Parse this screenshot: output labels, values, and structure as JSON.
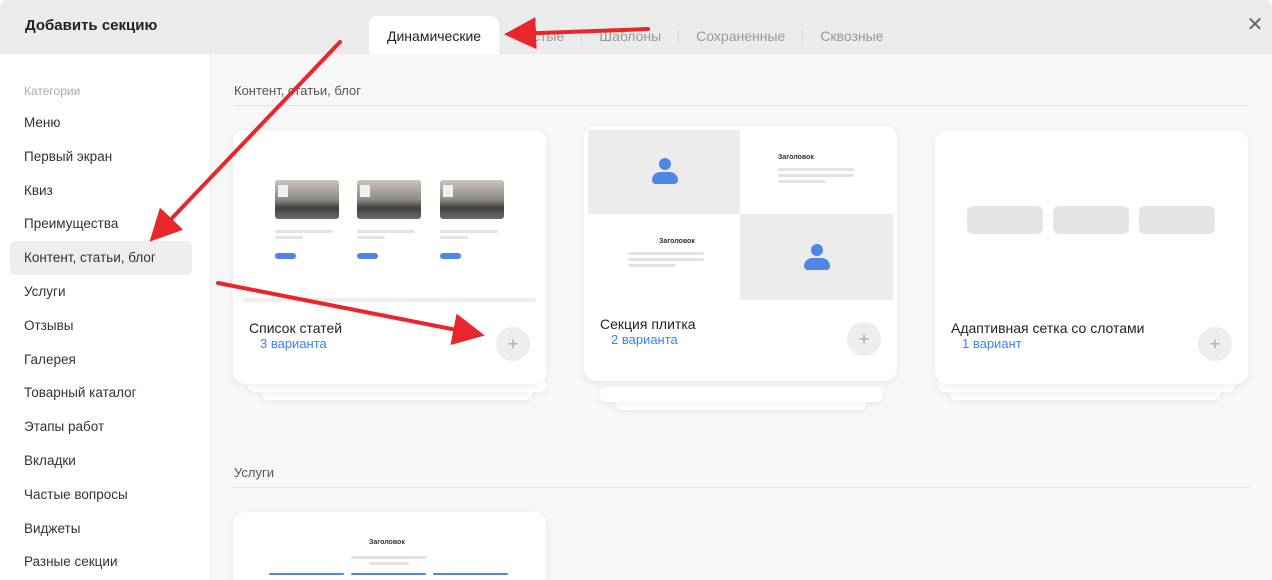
{
  "header": {
    "title": "Добавить секцию",
    "tabs": [
      {
        "label": "Динамические",
        "active": true
      },
      {
        "label": "Пустые",
        "active": false
      },
      {
        "label": "Шаблоны",
        "active": false
      },
      {
        "label": "Сохраненные",
        "active": false
      },
      {
        "label": "Сквозные",
        "active": false
      }
    ],
    "close_icon": "close-icon"
  },
  "sidebar": {
    "heading": "Категории",
    "items": [
      {
        "label": "Меню",
        "active": false
      },
      {
        "label": "Первый экран",
        "active": false
      },
      {
        "label": "Квиз",
        "active": false
      },
      {
        "label": "Преимущества",
        "active": false
      },
      {
        "label": "Контент, статьи, блог",
        "active": true
      },
      {
        "label": "Услуги",
        "active": false
      },
      {
        "label": "Отзывы",
        "active": false
      },
      {
        "label": "Галерея",
        "active": false
      },
      {
        "label": "Товарный каталог",
        "active": false
      },
      {
        "label": "Этапы работ",
        "active": false
      },
      {
        "label": "Вкладки",
        "active": false
      },
      {
        "label": "Частые вопросы",
        "active": false
      },
      {
        "label": "Виджеты",
        "active": false
      },
      {
        "label": "Разные секции",
        "active": false
      }
    ]
  },
  "main": {
    "sections": [
      {
        "title": "Контент, статьи, блог",
        "cards": [
          {
            "name": "Список статей",
            "variants": "3 варианта",
            "add": "+"
          },
          {
            "name": "Секция плитка",
            "variants": "2 варианта",
            "add": "+",
            "preview_heading_1": "Заголовок",
            "preview_heading_2": "Заголовок"
          },
          {
            "name": "Адаптивная сетка со слотами",
            "variants": "1 вариант",
            "add": "+"
          }
        ]
      },
      {
        "title": "Услуги",
        "cards": [
          {
            "preview_heading": "Заголовок"
          }
        ]
      }
    ]
  },
  "colors": {
    "accent": "#3b82f6",
    "annotation_arrow": "#e8262b",
    "header_bg": "#ebebeb",
    "content_bg": "#f7f7f7"
  }
}
